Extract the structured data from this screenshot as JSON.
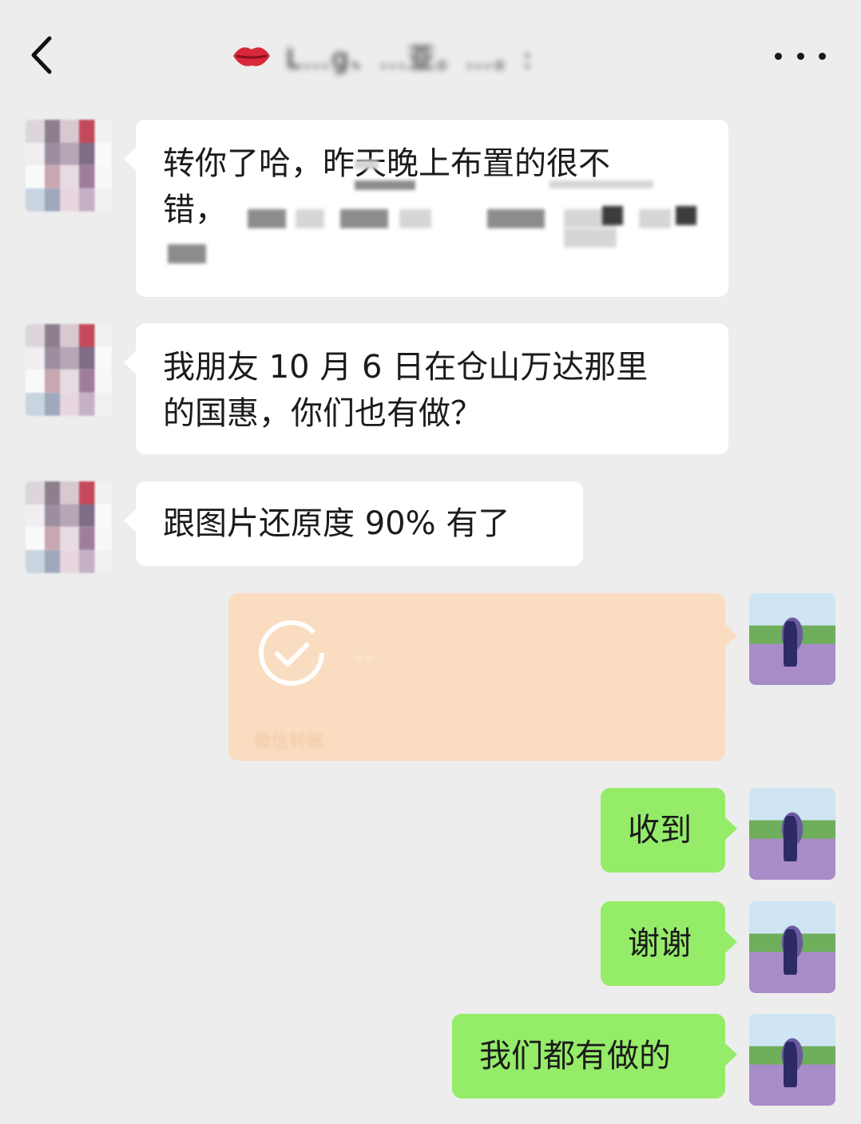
{
  "header": {
    "back_icon": "chevron-left-icon",
    "title_icon": "lips-emoji-icon",
    "title": "L…g、…亚。…。:",
    "more_icon": "more-dots-icon"
  },
  "messages": {
    "m1": {
      "line1": "转你了哈，昨天晚上布置的很不",
      "line2": "错，"
    },
    "m2": {
      "line1": "我朋友 10 月 6 日在仓山万达那里",
      "line2": "的国惠，你们也有做？"
    },
    "m3": {
      "text": "跟图片还原度 90% 有了"
    },
    "transfer": {
      "amount": "..",
      "footer": "微信转账",
      "icon": "check-circle-icon"
    },
    "m4": {
      "text": "收到"
    },
    "m5": {
      "text": "谢谢"
    },
    "m6": {
      "text": "我们都有做的"
    }
  },
  "colors": {
    "background": "#ededed",
    "incoming_bubble": "#ffffff",
    "outgoing_bubble": "#95ec69",
    "transfer_card": "#fbdcbf"
  }
}
